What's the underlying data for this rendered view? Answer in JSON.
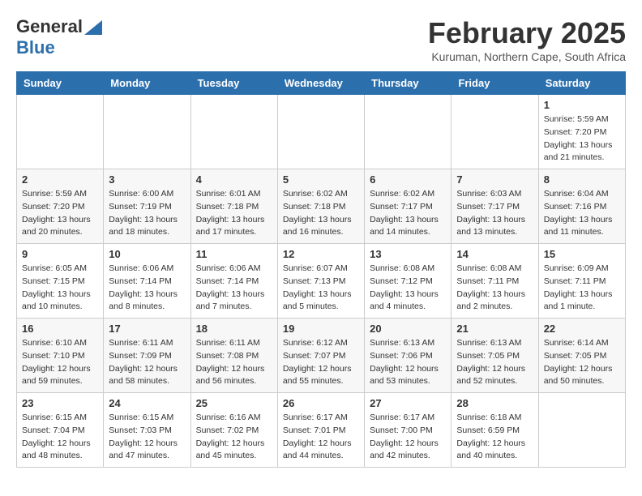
{
  "logo": {
    "general": "General",
    "blue": "Blue"
  },
  "header": {
    "month": "February 2025",
    "location": "Kuruman, Northern Cape, South Africa"
  },
  "weekdays": [
    "Sunday",
    "Monday",
    "Tuesday",
    "Wednesday",
    "Thursday",
    "Friday",
    "Saturday"
  ],
  "weeks": [
    [
      {
        "day": "",
        "info": ""
      },
      {
        "day": "",
        "info": ""
      },
      {
        "day": "",
        "info": ""
      },
      {
        "day": "",
        "info": ""
      },
      {
        "day": "",
        "info": ""
      },
      {
        "day": "",
        "info": ""
      },
      {
        "day": "1",
        "info": "Sunrise: 5:59 AM\nSunset: 7:20 PM\nDaylight: 13 hours and 21 minutes."
      }
    ],
    [
      {
        "day": "2",
        "info": "Sunrise: 5:59 AM\nSunset: 7:20 PM\nDaylight: 13 hours and 20 minutes."
      },
      {
        "day": "3",
        "info": "Sunrise: 6:00 AM\nSunset: 7:19 PM\nDaylight: 13 hours and 18 minutes."
      },
      {
        "day": "4",
        "info": "Sunrise: 6:01 AM\nSunset: 7:18 PM\nDaylight: 13 hours and 17 minutes."
      },
      {
        "day": "5",
        "info": "Sunrise: 6:02 AM\nSunset: 7:18 PM\nDaylight: 13 hours and 16 minutes."
      },
      {
        "day": "6",
        "info": "Sunrise: 6:02 AM\nSunset: 7:17 PM\nDaylight: 13 hours and 14 minutes."
      },
      {
        "day": "7",
        "info": "Sunrise: 6:03 AM\nSunset: 7:17 PM\nDaylight: 13 hours and 13 minutes."
      },
      {
        "day": "8",
        "info": "Sunrise: 6:04 AM\nSunset: 7:16 PM\nDaylight: 13 hours and 11 minutes."
      }
    ],
    [
      {
        "day": "9",
        "info": "Sunrise: 6:05 AM\nSunset: 7:15 PM\nDaylight: 13 hours and 10 minutes."
      },
      {
        "day": "10",
        "info": "Sunrise: 6:06 AM\nSunset: 7:14 PM\nDaylight: 13 hours and 8 minutes."
      },
      {
        "day": "11",
        "info": "Sunrise: 6:06 AM\nSunset: 7:14 PM\nDaylight: 13 hours and 7 minutes."
      },
      {
        "day": "12",
        "info": "Sunrise: 6:07 AM\nSunset: 7:13 PM\nDaylight: 13 hours and 5 minutes."
      },
      {
        "day": "13",
        "info": "Sunrise: 6:08 AM\nSunset: 7:12 PM\nDaylight: 13 hours and 4 minutes."
      },
      {
        "day": "14",
        "info": "Sunrise: 6:08 AM\nSunset: 7:11 PM\nDaylight: 13 hours and 2 minutes."
      },
      {
        "day": "15",
        "info": "Sunrise: 6:09 AM\nSunset: 7:11 PM\nDaylight: 13 hours and 1 minute."
      }
    ],
    [
      {
        "day": "16",
        "info": "Sunrise: 6:10 AM\nSunset: 7:10 PM\nDaylight: 12 hours and 59 minutes."
      },
      {
        "day": "17",
        "info": "Sunrise: 6:11 AM\nSunset: 7:09 PM\nDaylight: 12 hours and 58 minutes."
      },
      {
        "day": "18",
        "info": "Sunrise: 6:11 AM\nSunset: 7:08 PM\nDaylight: 12 hours and 56 minutes."
      },
      {
        "day": "19",
        "info": "Sunrise: 6:12 AM\nSunset: 7:07 PM\nDaylight: 12 hours and 55 minutes."
      },
      {
        "day": "20",
        "info": "Sunrise: 6:13 AM\nSunset: 7:06 PM\nDaylight: 12 hours and 53 minutes."
      },
      {
        "day": "21",
        "info": "Sunrise: 6:13 AM\nSunset: 7:05 PM\nDaylight: 12 hours and 52 minutes."
      },
      {
        "day": "22",
        "info": "Sunrise: 6:14 AM\nSunset: 7:05 PM\nDaylight: 12 hours and 50 minutes."
      }
    ],
    [
      {
        "day": "23",
        "info": "Sunrise: 6:15 AM\nSunset: 7:04 PM\nDaylight: 12 hours and 48 minutes."
      },
      {
        "day": "24",
        "info": "Sunrise: 6:15 AM\nSunset: 7:03 PM\nDaylight: 12 hours and 47 minutes."
      },
      {
        "day": "25",
        "info": "Sunrise: 6:16 AM\nSunset: 7:02 PM\nDaylight: 12 hours and 45 minutes."
      },
      {
        "day": "26",
        "info": "Sunrise: 6:17 AM\nSunset: 7:01 PM\nDaylight: 12 hours and 44 minutes."
      },
      {
        "day": "27",
        "info": "Sunrise: 6:17 AM\nSunset: 7:00 PM\nDaylight: 12 hours and 42 minutes."
      },
      {
        "day": "28",
        "info": "Sunrise: 6:18 AM\nSunset: 6:59 PM\nDaylight: 12 hours and 40 minutes."
      },
      {
        "day": "",
        "info": ""
      }
    ]
  ]
}
